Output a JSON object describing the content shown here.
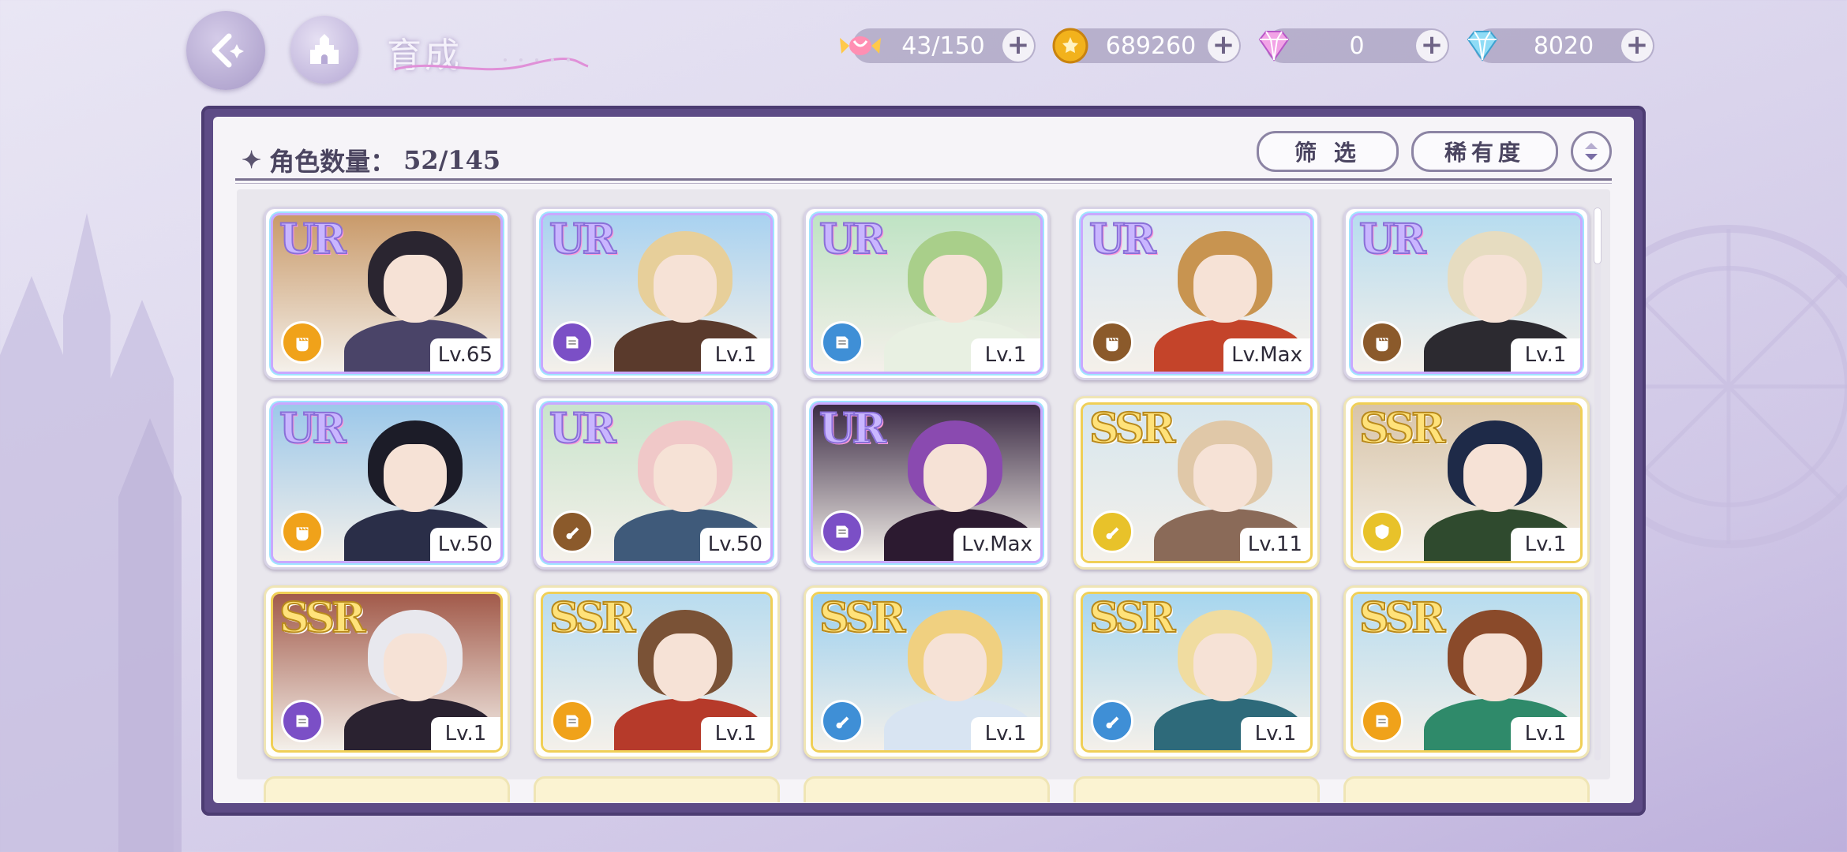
{
  "header": {
    "title": "育成",
    "currencies": [
      {
        "name": "candy-icon",
        "value": "43/150",
        "color": "#ff7fa8"
      },
      {
        "name": "gold-coin-icon",
        "value": "689260",
        "color": "#f2b21c"
      },
      {
        "name": "pink-diamond-icon",
        "value": "0",
        "color": "#e58ad9"
      },
      {
        "name": "blue-diamond-icon",
        "value": "8020",
        "color": "#5ec8f0"
      }
    ],
    "plus_symbol": "+"
  },
  "panel": {
    "count_label": "角色数量：",
    "count_value": "52/145",
    "filter_label": "筛 选",
    "sort_label": "稀有度"
  },
  "cards": [
    {
      "rarity": "UR",
      "level": "Lv.65",
      "role": "fist",
      "role_color": "#f0a21a",
      "hair": "#2a2530",
      "outfit": "#4a4468",
      "sky": "#c99a6a"
    },
    {
      "rarity": "UR",
      "level": "Lv.1",
      "role": "book",
      "role_color": "#7b4fc6",
      "hair": "#e7cf9a",
      "outfit": "#5a3a2c",
      "sky": "#a9d2f0"
    },
    {
      "rarity": "UR",
      "level": "Lv.1",
      "role": "book",
      "role_color": "#3f8fd6",
      "hair": "#a9cf8a",
      "outfit": "#e8f0e2",
      "sky": "#bfe3c4"
    },
    {
      "rarity": "UR",
      "level": "Lv.Max",
      "role": "fist",
      "role_color": "#8b5a2b",
      "hair": "#c89450",
      "outfit": "#c4442a",
      "sky": "#d8e6f2"
    },
    {
      "rarity": "UR",
      "level": "Lv.1",
      "role": "fist",
      "role_color": "#8b5a2b",
      "hair": "#e6dcc0",
      "outfit": "#2c2a30",
      "sky": "#b7dcef"
    },
    {
      "rarity": "UR",
      "level": "Lv.50",
      "role": "fist",
      "role_color": "#f0a21a",
      "hair": "#1c1c28",
      "outfit": "#2a2e48",
      "sky": "#9cc8ea"
    },
    {
      "rarity": "UR",
      "level": "Lv.50",
      "role": "horn",
      "role_color": "#8b5a2b",
      "hair": "#f0c8c8",
      "outfit": "#3f5a7a",
      "sky": "#c9e4cc"
    },
    {
      "rarity": "UR",
      "level": "Lv.Max",
      "role": "book",
      "role_color": "#7b4fc6",
      "hair": "#8a4ab0",
      "outfit": "#2c1a30",
      "sky": "#3b2a44"
    },
    {
      "rarity": "SSR",
      "level": "Lv.11",
      "role": "horn",
      "role_color": "#e8c22a",
      "hair": "#e0c8a8",
      "outfit": "#8a6a58",
      "sky": "#d6e6ee"
    },
    {
      "rarity": "SSR",
      "level": "Lv.1",
      "role": "shield",
      "role_color": "#e8c22a",
      "hair": "#1e2a48",
      "outfit": "#2f4a2e",
      "sky": "#d8c4a8"
    },
    {
      "rarity": "SSR",
      "level": "Lv.1",
      "role": "book",
      "role_color": "#7b4fc6",
      "hair": "#e8e8ee",
      "outfit": "#2a2230",
      "sky": "#a25a4a"
    },
    {
      "rarity": "SSR",
      "level": "Lv.1",
      "role": "book",
      "role_color": "#f0a21a",
      "hair": "#7a5236",
      "outfit": "#b63a2a",
      "sky": "#b9dcef"
    },
    {
      "rarity": "SSR",
      "level": "Lv.1",
      "role": "horn",
      "role_color": "#3f8fd6",
      "hair": "#f0d080",
      "outfit": "#d8e4f2",
      "sky": "#9cd0ef"
    },
    {
      "rarity": "SSR",
      "level": "Lv.1",
      "role": "horn",
      "role_color": "#3f8fd6",
      "hair": "#f0dca0",
      "outfit": "#2e6a7a",
      "sky": "#a7d6ee"
    },
    {
      "rarity": "SSR",
      "level": "Lv.1",
      "role": "book",
      "role_color": "#f0a21a",
      "hair": "#8a4a2a",
      "outfit": "#2f8a6a",
      "sky": "#b7dcef"
    }
  ]
}
